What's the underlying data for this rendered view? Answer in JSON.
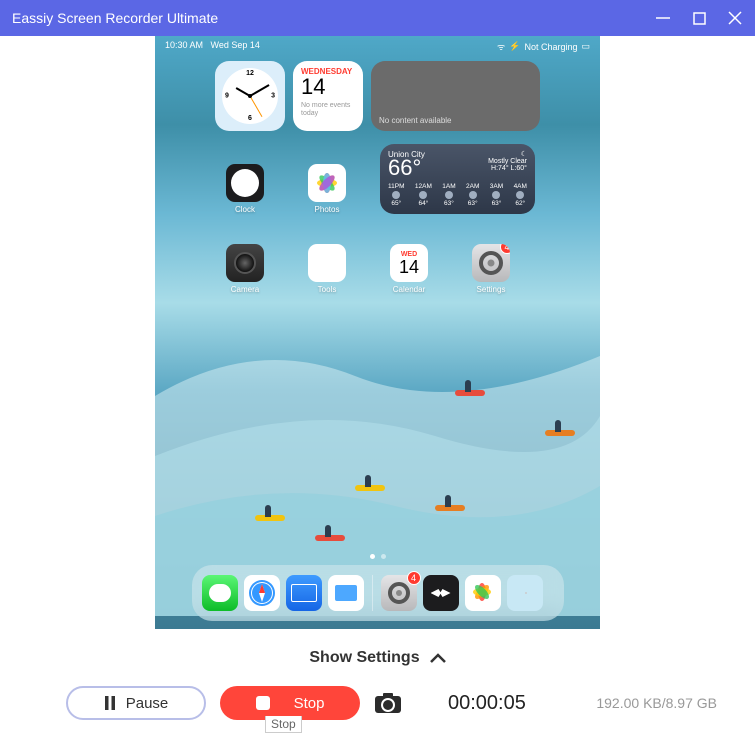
{
  "window": {
    "title": "Eassiy Screen Recorder Ultimate"
  },
  "ipad": {
    "status": {
      "time": "10:30 AM",
      "date": "Wed Sep 14",
      "charging": "Not Charging"
    },
    "clock_widget": {},
    "calendar_widget": {
      "dow": "WEDNESDAY",
      "day": "14",
      "noEvents": "No more events today"
    },
    "content_widget": {
      "msg": "No content available"
    },
    "weather": {
      "city": "Union City",
      "temp": "66°",
      "mostly": "Mostly Clear",
      "hilo": "H:74° L:60°",
      "days": [
        {
          "d": "11PM",
          "t": "65°"
        },
        {
          "d": "12AM",
          "t": "64°"
        },
        {
          "d": "1AM",
          "t": "63°"
        },
        {
          "d": "2AM",
          "t": "63°"
        },
        {
          "d": "3AM",
          "t": "63°"
        },
        {
          "d": "4AM",
          "t": "62°"
        }
      ]
    },
    "apps_r1": [
      {
        "id": "clock",
        "label": "Clock"
      },
      {
        "id": "photos",
        "label": "Photos"
      }
    ],
    "apps_r2": [
      {
        "id": "camera",
        "label": "Camera"
      },
      {
        "id": "tools",
        "label": "Tools"
      },
      {
        "id": "calendar",
        "label": "Calendar",
        "dow": "WED",
        "day": "14"
      },
      {
        "id": "settings",
        "label": "Settings",
        "badge": "4"
      }
    ],
    "dock_badge_settings": "4"
  },
  "showSettings": "Show Settings",
  "controls": {
    "pause": "Pause",
    "stop": "Stop",
    "stopTooltip": "Stop",
    "timer": "00:00:05",
    "filesize": "192.00 KB/8.97 GB"
  }
}
